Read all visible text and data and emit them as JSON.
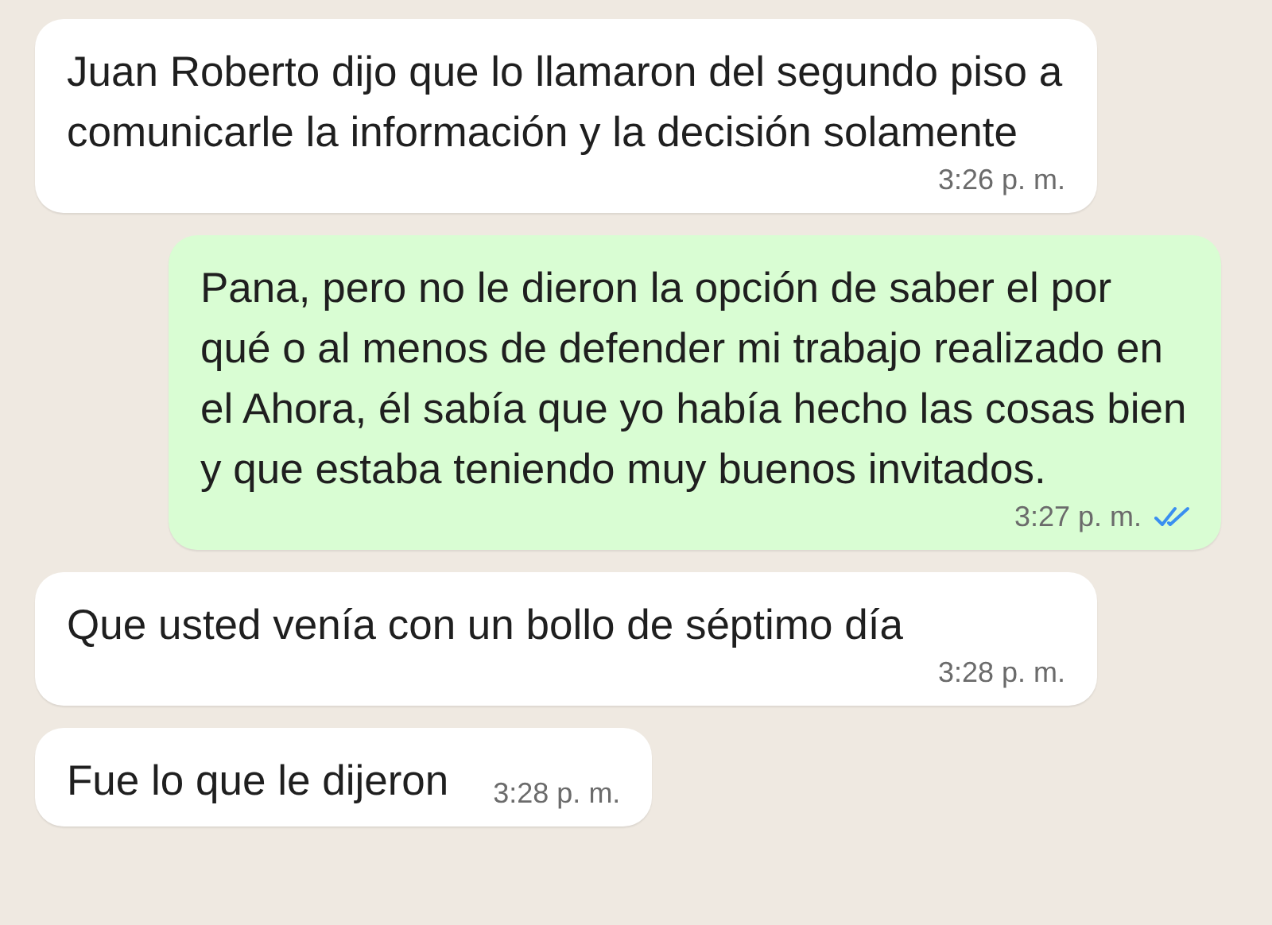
{
  "messages": [
    {
      "kind": "incoming",
      "text": "Juan Roberto dijo que lo llamaron del segundo piso a comunicarle la información y la decisión solamente",
      "time": "3:26 p. m."
    },
    {
      "kind": "outgoing",
      "text": "Pana, pero no le dieron la opción de saber el por qué o al menos de defender mi trabajo realizado en el Ahora, él sabía que yo había hecho las cosas bien y que estaba teniendo muy buenos invitados.",
      "time": "3:27 p. m.",
      "read": true
    },
    {
      "kind": "incoming",
      "text": "Que usted venía con un bollo de séptimo día",
      "time": "3:28 p. m."
    },
    {
      "kind": "incoming",
      "text": "Fue lo que le dijeron",
      "time": "3:28 p. m."
    }
  ]
}
